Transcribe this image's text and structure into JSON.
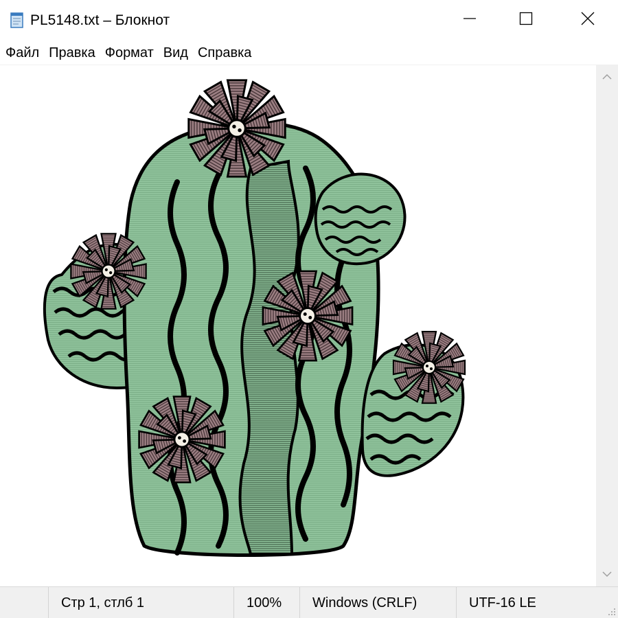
{
  "window": {
    "title": "PL5148.txt – Блокнот",
    "icon": "notepad-icon",
    "controls": [
      "minimize-icon",
      "maximize-icon",
      "close-icon"
    ]
  },
  "menu": {
    "items": [
      "Файл",
      "Правка",
      "Формат",
      "Вид",
      "Справка"
    ]
  },
  "editor": {
    "content_description": "ascii-art-cactus",
    "colors": {
      "cactus_green": "#8fc29b",
      "flower_mauve": "#9c7f83",
      "outline": "#000000",
      "background": "#ffffff"
    }
  },
  "status": {
    "position": "Стр 1, стлб 1",
    "zoom": "100%",
    "line_endings": "Windows (CRLF)",
    "encoding": "UTF-16 LE"
  }
}
